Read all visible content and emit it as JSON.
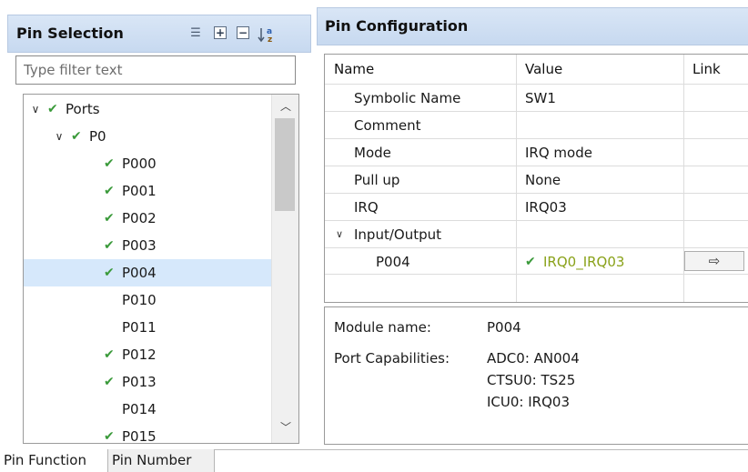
{
  "left_panel": {
    "title": "Pin Selection",
    "filter_placeholder": "Type filter text",
    "tree": [
      {
        "label": "Ports",
        "level": 0,
        "expanded": true,
        "checked": true,
        "selected": false
      },
      {
        "label": "P0",
        "level": 1,
        "expanded": true,
        "checked": true,
        "selected": false
      },
      {
        "label": "P000",
        "level": 2,
        "checked": true,
        "selected": false
      },
      {
        "label": "P001",
        "level": 2,
        "checked": true,
        "selected": false
      },
      {
        "label": "P002",
        "level": 2,
        "checked": true,
        "selected": false
      },
      {
        "label": "P003",
        "level": 2,
        "checked": true,
        "selected": false
      },
      {
        "label": "P004",
        "level": 2,
        "checked": true,
        "selected": true
      },
      {
        "label": "P010",
        "level": 2,
        "checked": false,
        "selected": false
      },
      {
        "label": "P011",
        "level": 2,
        "checked": false,
        "selected": false
      },
      {
        "label": "P012",
        "level": 2,
        "checked": true,
        "selected": false
      },
      {
        "label": "P013",
        "level": 2,
        "checked": true,
        "selected": false
      },
      {
        "label": "P014",
        "level": 2,
        "checked": false,
        "selected": false
      },
      {
        "label": "P015",
        "level": 2,
        "checked": true,
        "selected": false
      }
    ]
  },
  "right_panel": {
    "title": "Pin Configuration",
    "columns": [
      "Name",
      "Value",
      "Link"
    ],
    "rows": [
      {
        "name": "Symbolic Name",
        "value": "SW1"
      },
      {
        "name": "Comment",
        "value": ""
      },
      {
        "name": "Mode",
        "value": "IRQ mode"
      },
      {
        "name": "Pull up",
        "value": "None"
      },
      {
        "name": "IRQ",
        "value": "IRQ03"
      },
      {
        "name": "Input/Output",
        "value": ""
      },
      {
        "name": "P004",
        "value": "IRQ0_IRQ03"
      }
    ],
    "link_button_glyph": "⇨",
    "module_name_label": "Module name:",
    "module_name_value": "P004",
    "port_capabilities_label": "Port Capabilities:",
    "port_capabilities": [
      "ADC0: AN004",
      "CTSU0: TS25",
      "ICU0: IRQ03"
    ]
  },
  "bottom_tabs": [
    "Pin Function",
    "Pin Number"
  ],
  "colors": {
    "header_bg": "#c7d9f0",
    "selection_bg": "#d6e8fb",
    "check_green": "#3a9a3a",
    "value_green": "#8aa21a"
  }
}
